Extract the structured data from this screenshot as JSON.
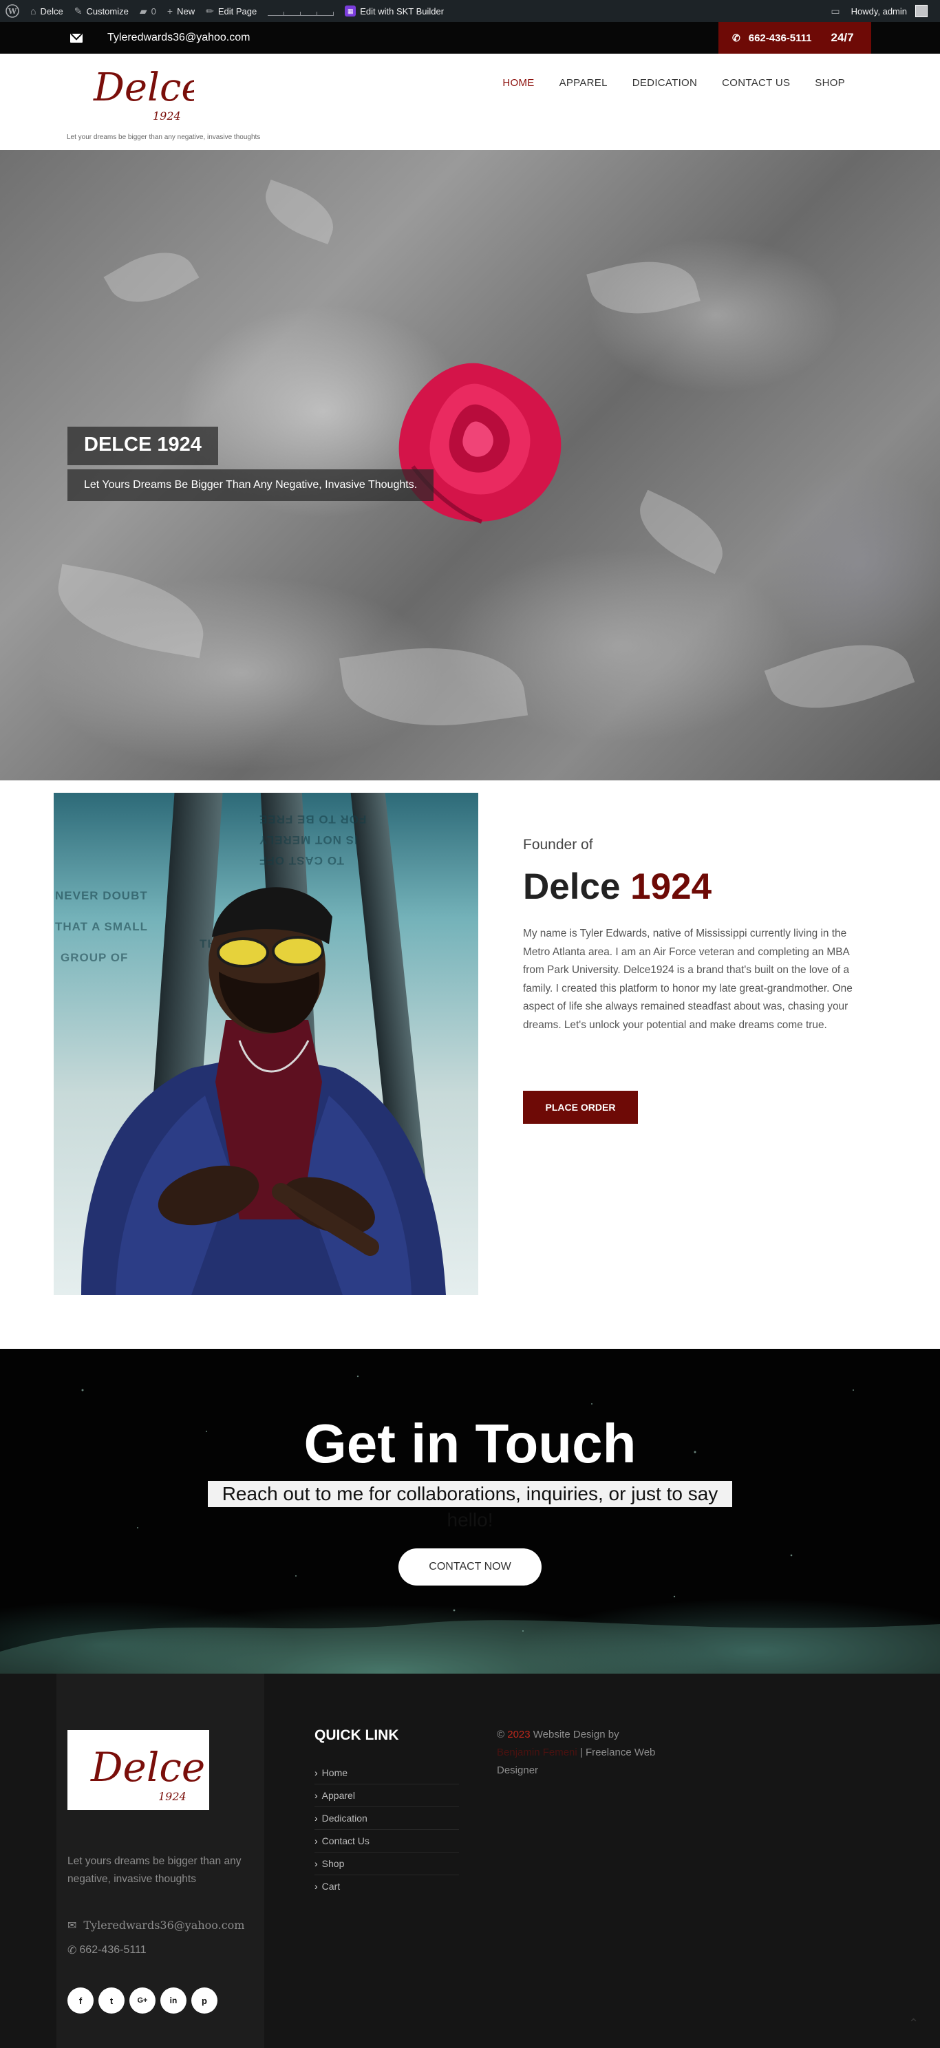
{
  "adminbar": {
    "site_name": "Delce",
    "customize": "Customize",
    "comments_count": "0",
    "new_label": "New",
    "edit_page": "Edit Page",
    "skt_builder": "Edit with SKT Builder",
    "howdy": "Howdy, admin"
  },
  "topbar": {
    "email": "Tyleredwards36@yahoo.com",
    "phone": "662-436-5111",
    "availability": "24/7",
    "accent_color": "#6e0a06"
  },
  "header": {
    "logo_main": "Delce",
    "logo_year": "1924",
    "tagline": "Let your dreams be bigger than any negative, invasive thoughts",
    "nav": [
      {
        "label": "HOME"
      },
      {
        "label": "APPAREL"
      },
      {
        "label": "DEDICATION"
      },
      {
        "label": "CONTACT US"
      },
      {
        "label": "SHOP"
      }
    ]
  },
  "hero": {
    "title": "DELCE 1924",
    "subtitle": "Let Yours Dreams Be Bigger Than Any Negative, Invasive Thoughts."
  },
  "founder": {
    "label": "Founder of",
    "name_main": "Delce",
    "name_accent": "1924",
    "bio": "My name is Tyler Edwards, native of Mississippi currently living in the Metro Atlanta area. I am an Air Force veteran and completing an MBA from Park University. Delce1924 is a brand that's built on the love of a family. I created this platform to honor my late great-grandmother. One aspect of life she always remained steadfast about was, chasing your dreams. Let's unlock your potential and make dreams come true.",
    "cta": "PLACE ORDER",
    "glass_lines": [
      "NEVER DOUBT",
      "THAT A SMALL",
      "GROUP OF",
      "TO CAST OFF",
      "IS NOT MERELY",
      "FOR TO BE FREE",
      "THAT"
    ]
  },
  "touch": {
    "title": "Get in Touch",
    "subtitle": "Reach out to me for collaborations, inquiries, or just to say hello!",
    "cta": "CONTACT NOW"
  },
  "footer": {
    "logo_main": "Delce",
    "logo_year": "1924",
    "tagline": "Let yours dreams be bigger than any negative, invasive thoughts",
    "email": "Tyleredwards36@yahoo.com",
    "phone": "662-436-5111",
    "quick_link_title": "QUICK LINK",
    "quick_links": [
      {
        "label": "Home"
      },
      {
        "label": "Apparel"
      },
      {
        "label": "Dedication"
      },
      {
        "label": "Contact Us"
      },
      {
        "label": "Shop"
      },
      {
        "label": "Cart"
      }
    ],
    "credit_copy": "©",
    "credit_year": "2023",
    "credit_text": "Website Design by",
    "credit_link": "Benjamin Femeni",
    "credit_tail": "| Freelance Web Designer",
    "socials": [
      {
        "icon": "facebook-icon",
        "glyph": "f"
      },
      {
        "icon": "twitter-icon",
        "glyph": "t"
      },
      {
        "icon": "google-plus-icon",
        "glyph": "G+"
      },
      {
        "icon": "linkedin-icon",
        "glyph": "in"
      },
      {
        "icon": "pinterest-icon",
        "glyph": "p"
      }
    ]
  }
}
